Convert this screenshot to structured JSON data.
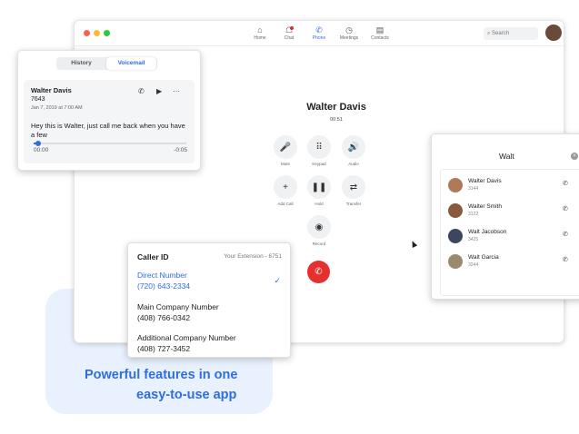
{
  "promo": {
    "line1": "Powerful features in one",
    "line2": "easy-to-use app"
  },
  "window": {
    "nav": [
      {
        "label": "Home",
        "icon": "⌂"
      },
      {
        "label": "Chat",
        "icon": "☖"
      },
      {
        "label": "Phone",
        "icon": "✆"
      },
      {
        "label": "Meetings",
        "icon": "◷"
      },
      {
        "label": "Contacts",
        "icon": "▤"
      }
    ],
    "search_placeholder": "Search",
    "search_icon": "⌕"
  },
  "call": {
    "name": "Walter Davis",
    "duration": "00:51",
    "controls": [
      {
        "label": "Mute",
        "icon": "🎤"
      },
      {
        "label": "Keypad",
        "icon": "⠿"
      },
      {
        "label": "Audio",
        "icon": "🔊"
      },
      {
        "label": "Add Call",
        "icon": "+"
      },
      {
        "label": "Hold",
        "icon": "❚❚"
      },
      {
        "label": "Transfer",
        "icon": "⇄"
      },
      {
        "label": "Record",
        "icon": "◉"
      }
    ],
    "end_icon": "✆"
  },
  "voicemail": {
    "tab_history": "History",
    "tab_voicemail": "Voicemail",
    "name": "Walter Davis",
    "ext": "7643",
    "date": "Jan 7, 2019 at 7:00 AM",
    "message": "Hey this is Walter, just call me back when you have a few",
    "time_start": "00:00",
    "time_end": "-0:05",
    "progress": 0.03,
    "icons": {
      "call": "✆",
      "play": "▶",
      "more": "···"
    }
  },
  "caller_id": {
    "title": "Caller ID",
    "extension": "Your Extension - 6751",
    "check": "✓",
    "options": [
      {
        "name": "Direct Number",
        "number": "(720) 643-2334",
        "selected": true
      },
      {
        "name": "Main Company Number",
        "number": "(408) 766-0342",
        "selected": false
      },
      {
        "name": "Additional Company Number",
        "number": "(408) 727-3452",
        "selected": false
      }
    ]
  },
  "contact_search": {
    "query": "Walt",
    "clear_icon": "×",
    "results": [
      {
        "name": "Walter Davis",
        "ext": "3144",
        "phone_icon": "✆"
      },
      {
        "name": "Walter Smith",
        "ext": "3122",
        "phone_icon": "✆"
      },
      {
        "name": "Walt Jacobson",
        "ext": "3425",
        "phone_icon": "✆"
      },
      {
        "name": "Walt Garcia",
        "ext": "3244",
        "phone_icon": "✆"
      }
    ]
  },
  "colors": {
    "accent": "#2f6ee0",
    "end_call": "#e5302f",
    "promo_bg": "#e8f1fd"
  }
}
